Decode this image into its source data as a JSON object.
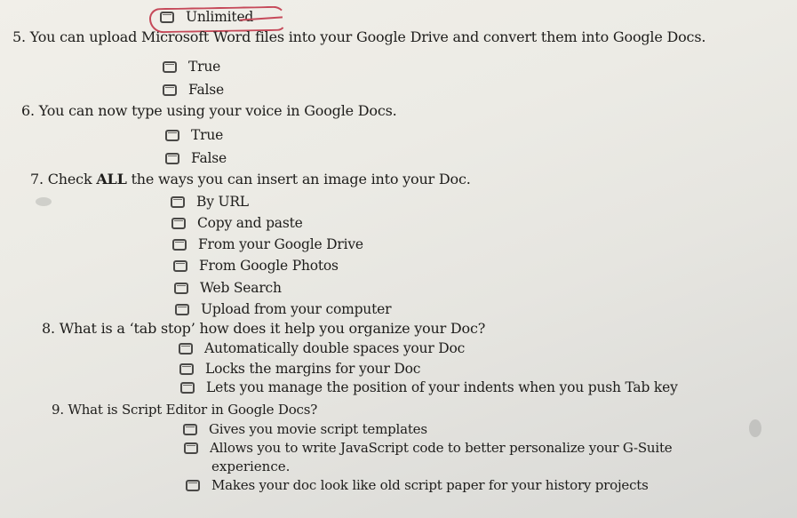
{
  "worksheet": {
    "prev_option": {
      "label": "Unlimited",
      "annotation_color": "#c64a5a",
      "circled": true
    },
    "questions": [
      {
        "number": "5.",
        "text": "You can upload Microsoft Word files into your Google Drive and convert them into Google Docs.",
        "options": [
          "True",
          "False"
        ]
      },
      {
        "number": "6.",
        "text": "You can now type using your voice in Google Docs.",
        "options": [
          "True",
          "False"
        ]
      },
      {
        "number": "7.",
        "text_before": "Check",
        "text_bold": "ALL",
        "text_after": "the ways you can insert an image into your Doc.",
        "options": [
          "By URL",
          "Copy and paste",
          "From your Google Drive",
          "From Google Photos",
          "Web Search",
          "Upload from your computer"
        ]
      },
      {
        "number": "8.",
        "text": "What is a ‘tab stop’ how does it help you organize your Doc?",
        "options": [
          "Automatically double spaces your Doc",
          "Locks the margins for your Doc",
          "Lets you manage the position of your indents when you push Tab key"
        ]
      },
      {
        "number": "9.",
        "text": "What is Script Editor in Google Docs?",
        "options": [
          "Gives you movie script templates",
          "Allows you to write JavaScript code to better personalize your G-Suite",
          "Makes your doc look like old script paper for your history projects"
        ],
        "option_continuation": "experience."
      }
    ]
  }
}
